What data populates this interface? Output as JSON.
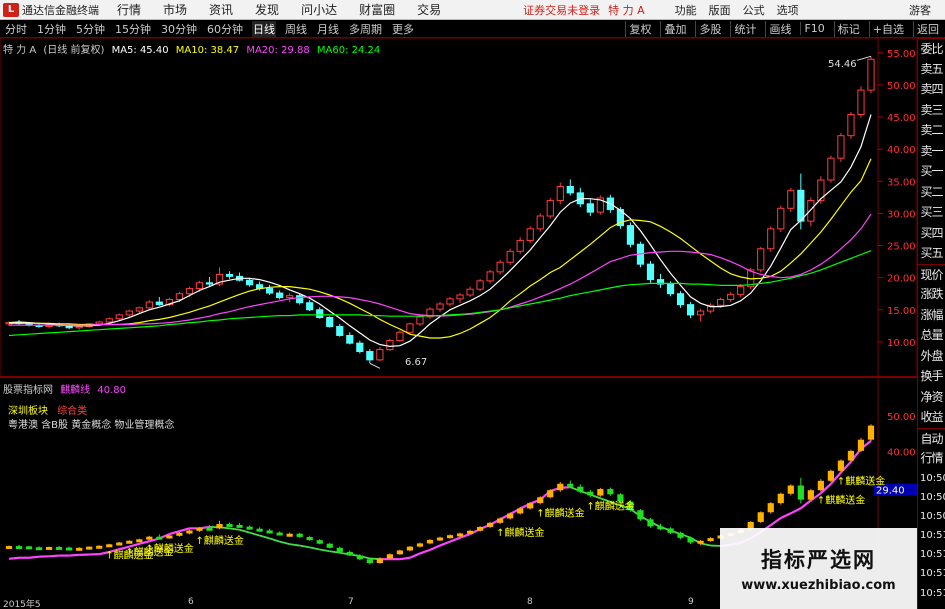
{
  "app": {
    "logo": "L",
    "title": "通达信金融终端",
    "menus": [
      "行情",
      "市场",
      "资讯",
      "发现",
      "问小达",
      "财富圈",
      "交易"
    ],
    "login_status": "证券交易未登录",
    "stock_name": "特 力 A",
    "right_menus": [
      "功能",
      "版面",
      "公式",
      "选项"
    ],
    "guest": "游客"
  },
  "toolbar": {
    "periods": [
      "分时",
      "1分钟",
      "5分钟",
      "15分钟",
      "30分钟",
      "60分钟",
      "日线",
      "周线",
      "月线",
      "多周期",
      "更多"
    ],
    "active_period": "日线",
    "right_buttons": [
      "复权",
      "叠加",
      "多股",
      "统计",
      "画线",
      "F10",
      "标记",
      "+自选",
      "返回"
    ]
  },
  "main_legend": {
    "name": "特 力 A",
    "mode": "(日线 前复权)",
    "ma5_label": "MA5: 45.40",
    "ma10_label": "MA10: 38.47",
    "ma20_label": "MA20: 29.88",
    "ma60_label": "MA60: 24.24",
    "colors": {
      "ma5": "#ffffff",
      "ma10": "#ffff00",
      "ma20": "#ff44ff",
      "ma60": "#00ff00"
    }
  },
  "main_axis": [
    "55.00",
    "50.00",
    "45.00",
    "40.00",
    "35.00",
    "30.00",
    "25.00",
    "20.00",
    "15.00",
    "10.00"
  ],
  "sub_axis": [
    "50.00",
    "40.00",
    "10:50",
    "10:50",
    "10:51",
    "10:51",
    "10:51",
    "10:51"
  ],
  "sub_axis_marker": "29.40",
  "price_high": "54.46",
  "price_low": "6.67",
  "sub_legend": {
    "name": "股票指标网",
    "indicator": "麒麟线",
    "value": "40.80",
    "sector_label": "深圳板块",
    "sector_value": "综合类",
    "concepts": "粤港澳 含B股 黄金概念 物业管理概念"
  },
  "signal_label": "↑麒麟送金",
  "quote_panel": [
    "委比",
    "卖五",
    "卖四",
    "卖三",
    "卖二",
    "卖一",
    "买一",
    "买二",
    "买三",
    "买四",
    "买五",
    "现价",
    "涨跌",
    "涨幅",
    "总量",
    "外盘",
    "换手",
    "净资",
    "收益",
    "自动",
    "行情"
  ],
  "quote_times": [
    "10:50",
    "10:50",
    "10:50",
    "10:51",
    "10:51",
    "10:51",
    "10:51"
  ],
  "watermark": {
    "title": "指标严选网",
    "url": "www.xuezhibiao.com"
  },
  "date_axis": [
    "2015年5",
    "6",
    "7",
    "8",
    "9"
  ],
  "chart_data": {
    "type": "candlestick",
    "title": "特 力 A (日线 前复权)",
    "ylim": [
      5,
      57
    ],
    "candles": [
      [
        12.8,
        13.2,
        12.5,
        13.0
      ],
      [
        13.0,
        13.4,
        12.7,
        12.9
      ],
      [
        12.9,
        13.1,
        12.4,
        12.6
      ],
      [
        12.6,
        12.9,
        12.2,
        12.4
      ],
      [
        12.4,
        12.8,
        12.1,
        12.7
      ],
      [
        12.7,
        13.0,
        12.3,
        12.5
      ],
      [
        12.5,
        12.8,
        12.0,
        12.2
      ],
      [
        12.2,
        12.6,
        11.9,
        12.4
      ],
      [
        12.4,
        12.9,
        12.2,
        12.8
      ],
      [
        12.8,
        13.3,
        12.6,
        13.1
      ],
      [
        13.1,
        13.8,
        12.9,
        13.6
      ],
      [
        13.6,
        14.4,
        13.3,
        14.2
      ],
      [
        14.2,
        15.0,
        13.9,
        14.8
      ],
      [
        14.8,
        15.5,
        14.5,
        15.3
      ],
      [
        15.3,
        16.5,
        15.0,
        16.2
      ],
      [
        16.2,
        17.0,
        15.6,
        15.8
      ],
      [
        15.8,
        16.9,
        15.5,
        16.6
      ],
      [
        16.6,
        17.8,
        16.2,
        17.5
      ],
      [
        17.5,
        18.6,
        17.0,
        18.3
      ],
      [
        18.3,
        19.5,
        17.8,
        19.2
      ],
      [
        19.2,
        20.1,
        18.6,
        19.0
      ],
      [
        19.0,
        21.6,
        18.7,
        20.5
      ],
      [
        20.5,
        21.0,
        19.8,
        20.2
      ],
      [
        20.2,
        20.8,
        19.4,
        19.6
      ],
      [
        19.6,
        20.0,
        18.6,
        18.9
      ],
      [
        18.9,
        19.4,
        18.0,
        18.3
      ],
      [
        18.3,
        18.9,
        17.3,
        17.6
      ],
      [
        17.6,
        18.0,
        16.6,
        16.9
      ],
      [
        16.9,
        17.6,
        16.2,
        17.2
      ],
      [
        17.2,
        17.5,
        15.8,
        16.1
      ],
      [
        16.1,
        16.5,
        14.8,
        15.0
      ],
      [
        15.0,
        15.4,
        13.6,
        13.8
      ],
      [
        13.8,
        14.0,
        12.2,
        12.4
      ],
      [
        12.4,
        12.8,
        10.8,
        11.0
      ],
      [
        11.0,
        11.5,
        9.6,
        9.8
      ],
      [
        9.8,
        10.2,
        8.2,
        8.5
      ],
      [
        8.5,
        8.9,
        6.7,
        7.2
      ],
      [
        7.2,
        9.2,
        7.0,
        8.8
      ],
      [
        8.8,
        10.5,
        8.6,
        10.2
      ],
      [
        10.2,
        11.8,
        10.0,
        11.5
      ],
      [
        11.5,
        13.0,
        11.2,
        12.8
      ],
      [
        12.8,
        14.2,
        12.5,
        13.9
      ],
      [
        13.9,
        15.4,
        13.6,
        15.1
      ],
      [
        15.1,
        16.2,
        14.7,
        15.9
      ],
      [
        15.9,
        17.0,
        15.5,
        16.7
      ],
      [
        16.7,
        17.6,
        16.1,
        17.3
      ],
      [
        17.3,
        18.6,
        17.0,
        18.2
      ],
      [
        18.2,
        19.8,
        17.9,
        19.5
      ],
      [
        19.5,
        21.2,
        19.1,
        20.9
      ],
      [
        20.9,
        22.8,
        20.5,
        22.4
      ],
      [
        22.4,
        24.5,
        22.0,
        24.1
      ],
      [
        24.1,
        26.3,
        23.7,
        25.8
      ],
      [
        25.8,
        28.0,
        25.4,
        27.6
      ],
      [
        27.6,
        30.0,
        27.2,
        29.6
      ],
      [
        29.6,
        32.4,
        29.2,
        32.0
      ],
      [
        32.0,
        34.8,
        31.4,
        34.2
      ],
      [
        34.2,
        35.3,
        32.8,
        33.2
      ],
      [
        33.2,
        34.0,
        31.0,
        31.5
      ],
      [
        31.5,
        32.2,
        29.6,
        30.2
      ],
      [
        30.2,
        32.8,
        29.8,
        32.4
      ],
      [
        32.4,
        32.9,
        30.1,
        30.6
      ],
      [
        30.6,
        31.0,
        27.6,
        28.1
      ],
      [
        28.1,
        28.6,
        24.7,
        25.2
      ],
      [
        25.2,
        25.6,
        21.6,
        22.1
      ],
      [
        22.1,
        22.6,
        19.2,
        19.7
      ],
      [
        19.7,
        20.6,
        18.4,
        19.0
      ],
      [
        19.0,
        19.4,
        17.1,
        17.5
      ],
      [
        17.5,
        17.9,
        15.3,
        15.8
      ],
      [
        15.8,
        16.2,
        13.7,
        14.2
      ],
      [
        14.2,
        15.1,
        13.2,
        14.8
      ],
      [
        14.8,
        16.0,
        14.5,
        15.7
      ],
      [
        15.7,
        16.9,
        15.3,
        16.6
      ],
      [
        16.6,
        17.8,
        16.2,
        17.4
      ],
      [
        17.4,
        19.0,
        17.0,
        18.6
      ],
      [
        18.6,
        21.5,
        18.2,
        21.2
      ],
      [
        21.2,
        24.8,
        20.8,
        24.5
      ],
      [
        24.5,
        28.0,
        24.0,
        27.6
      ],
      [
        27.6,
        31.2,
        27.1,
        30.8
      ],
      [
        30.8,
        34.0,
        30.2,
        33.6
      ],
      [
        33.6,
        36.2,
        27.5,
        28.8
      ],
      [
        28.8,
        32.5,
        28.0,
        32.0
      ],
      [
        32.0,
        35.8,
        31.5,
        35.2
      ],
      [
        35.2,
        39.0,
        34.8,
        38.6
      ],
      [
        38.6,
        42.5,
        38.0,
        42.1
      ],
      [
        42.1,
        45.8,
        41.6,
        45.4
      ],
      [
        45.4,
        49.8,
        44.9,
        49.2
      ],
      [
        49.2,
        54.46,
        48.7,
        54.0
      ]
    ],
    "ma_series": [
      {
        "name": "MA5",
        "color": "#ffffff",
        "values": [
          13.0,
          13.1,
          13.0,
          12.9,
          12.8,
          12.6,
          12.5,
          12.5,
          12.5,
          12.6,
          12.9,
          13.3,
          13.8,
          14.4,
          15.0,
          15.4,
          15.9,
          16.4,
          17.2,
          18.0,
          18.6,
          19.3,
          19.6,
          19.9,
          19.9,
          19.7,
          19.3,
          18.8,
          18.1,
          17.5,
          16.8,
          15.9,
          14.8,
          13.7,
          12.5,
          11.4,
          10.3,
          9.6,
          9.3,
          9.4,
          10.1,
          11.4,
          12.8,
          13.9,
          15.0,
          15.7,
          16.4,
          17.2,
          18.2,
          19.6,
          21.1,
          22.7,
          24.3,
          26.2,
          28.1,
          30.2,
          31.6,
          32.3,
          32.3,
          32.1,
          31.5,
          30.5,
          29.2,
          27.3,
          25.1,
          22.8,
          20.7,
          18.8,
          17.0,
          16.0,
          15.5,
          15.5,
          15.7,
          16.4,
          17.6,
          19.5,
          21.8,
          24.6,
          27.5,
          28.9,
          30.6,
          32.3,
          33.6,
          34.9,
          37.2,
          40.4,
          45.4
        ]
      },
      {
        "name": "MA10",
        "color": "#ffff00",
        "values": [
          12.9,
          12.9,
          12.9,
          12.9,
          12.9,
          12.8,
          12.8,
          12.7,
          12.7,
          12.7,
          12.7,
          12.7,
          12.8,
          13.0,
          13.3,
          13.5,
          13.8,
          14.2,
          14.6,
          15.1,
          15.6,
          16.2,
          16.8,
          17.4,
          17.9,
          18.3,
          18.5,
          18.6,
          18.6,
          18.4,
          18.2,
          17.8,
          17.3,
          16.7,
          16.0,
          15.2,
          14.4,
          13.5,
          12.7,
          12.0,
          11.2,
          10.9,
          10.6,
          10.6,
          10.8,
          11.3,
          12.0,
          12.9,
          13.8,
          15.0,
          16.4,
          17.5,
          18.7,
          19.7,
          20.8,
          21.6,
          22.8,
          24.0,
          25.2,
          26.5,
          27.8,
          28.6,
          29.0,
          28.9,
          28.7,
          28.0,
          27.1,
          26.1,
          24.9,
          23.7,
          22.6,
          21.5,
          20.6,
          20.1,
          19.8,
          19.9,
          20.2,
          21.0,
          22.3,
          23.7,
          25.4,
          27.1,
          29.1,
          31.2,
          33.3,
          35.1,
          38.5
        ]
      },
      {
        "name": "MA20",
        "color": "#ff44ff",
        "values": [
          12.6,
          12.6,
          12.6,
          12.6,
          12.6,
          12.6,
          12.6,
          12.6,
          12.6,
          12.7,
          12.7,
          12.7,
          12.7,
          12.8,
          12.8,
          12.9,
          13.0,
          13.2,
          13.4,
          13.7,
          14.0,
          14.4,
          14.7,
          15.1,
          15.5,
          15.8,
          16.1,
          16.4,
          16.7,
          16.9,
          17.0,
          17.1,
          17.1,
          17.0,
          16.9,
          16.6,
          16.3,
          15.9,
          15.4,
          14.9,
          14.4,
          14.2,
          14.1,
          14.0,
          14.1,
          14.2,
          14.3,
          14.5,
          14.7,
          15.0,
          15.4,
          15.9,
          16.4,
          17.0,
          17.6,
          18.3,
          19.0,
          19.8,
          20.7,
          21.6,
          22.5,
          23.0,
          23.5,
          23.7,
          23.9,
          24.0,
          24.1,
          24.1,
          24.0,
          23.8,
          23.6,
          23.1,
          22.5,
          21.8,
          21.0,
          20.5,
          20.2,
          20.0,
          20.1,
          20.5,
          21.2,
          22.1,
          23.2,
          24.5,
          25.9,
          27.6,
          29.9
        ]
      },
      {
        "name": "MA60",
        "color": "#00ff00",
        "values": [
          11.0,
          11.1,
          11.2,
          11.3,
          11.4,
          11.5,
          11.6,
          11.7,
          11.8,
          11.9,
          12.0,
          12.1,
          12.2,
          12.3,
          12.4,
          12.5,
          12.7,
          12.8,
          13.0,
          13.1,
          13.3,
          13.4,
          13.6,
          13.7,
          13.8,
          13.9,
          14.0,
          14.1,
          14.1,
          14.2,
          14.2,
          14.2,
          14.2,
          14.2,
          14.2,
          14.2,
          14.1,
          14.1,
          14.0,
          14.0,
          14.0,
          14.0,
          14.1,
          14.1,
          14.2,
          14.3,
          14.4,
          14.6,
          14.8,
          15.0,
          15.3,
          15.6,
          15.9,
          16.2,
          16.5,
          16.8,
          17.2,
          17.5,
          17.8,
          18.1,
          18.4,
          18.7,
          18.9,
          19.0,
          19.1,
          19.1,
          19.1,
          19.1,
          19.0,
          19.0,
          18.9,
          18.8,
          18.8,
          18.8,
          18.9,
          19.1,
          19.3,
          19.6,
          19.9,
          20.3,
          20.7,
          21.2,
          21.8,
          22.4,
          23.0,
          23.6,
          24.2
        ]
      }
    ],
    "sub_series": {
      "name": "麒麟线",
      "ylim": [
        0,
        60
      ],
      "line": [
        10.1,
        10.4,
        10.4,
        10.7,
        10.8,
        11.0,
        11.0,
        11.2,
        11.3,
        11.4,
        12.0,
        12.8,
        13.5,
        14.3,
        15.0,
        15.8,
        17.0,
        17.8,
        18.6,
        18.6,
        19.0,
        18.9,
        18.6,
        18.2,
        17.4,
        16.6,
        15.8,
        14.9,
        14.2,
        13.8,
        13.3,
        12.7,
        12.2,
        11.8,
        11.3,
        10.9,
        10.2,
        10.0,
        10.0,
        10.0,
        10.4,
        11.6,
        12.6,
        13.8,
        14.9,
        16.0,
        17.0,
        18.4,
        19.6,
        21.1,
        22.6,
        24.1,
        25.5,
        26.6,
        29.0,
        29.9,
        30.1,
        29.0,
        28.0,
        27.0,
        26.0,
        25.0,
        24.0,
        22.0,
        20.4,
        19.0,
        18.0,
        17.0,
        16.0,
        14.4,
        13.8,
        13.7,
        14.0,
        14.6,
        15.8,
        17.6,
        19.5,
        21.5,
        22.8,
        24.2,
        26.4,
        28.4,
        31.0,
        34.2,
        37.2,
        40.8,
        43.0
      ]
    }
  }
}
